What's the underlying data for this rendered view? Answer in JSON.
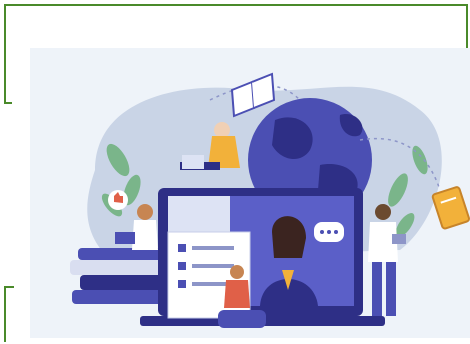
{
  "illustration": {
    "subject": "online-learning",
    "colors": {
      "primary_blue": "#4b4fb3",
      "dark_blue": "#2e2f86",
      "light_bg": "#e8f0f8",
      "blob_blue": "#c9d4e6",
      "frame_green": "#4a8a2a",
      "accent_orange": "#f2b13a",
      "leaf_green": "#7ab58a"
    },
    "icons": [
      "globe-icon",
      "laptop-icon",
      "book-icon",
      "chat-bubble-icon",
      "like-icon"
    ]
  }
}
